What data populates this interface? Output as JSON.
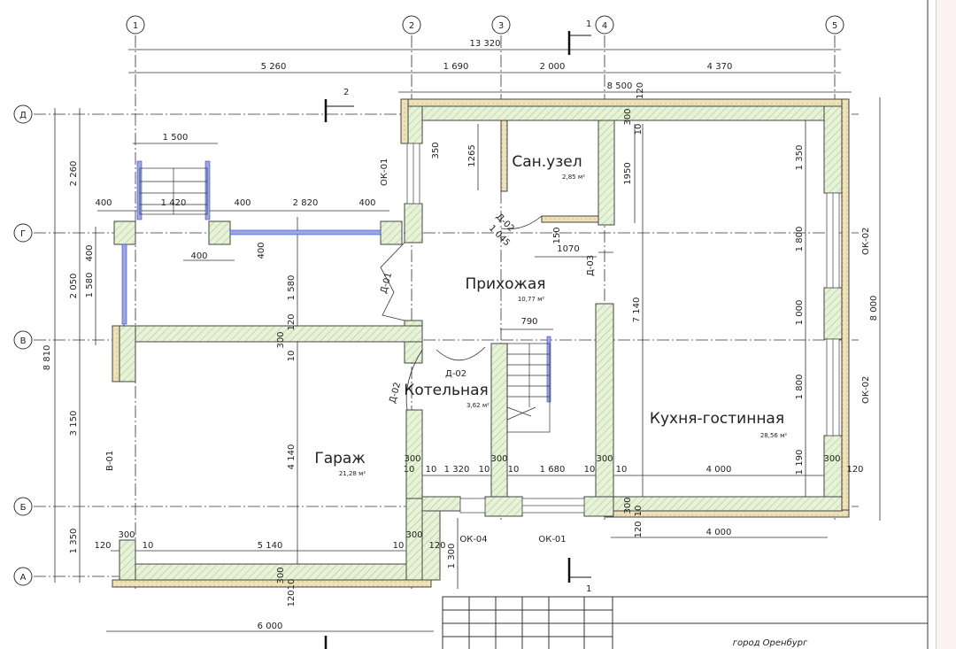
{
  "drawing": {
    "axes_vertical": [
      "1",
      "2",
      "3",
      "4",
      "5"
    ],
    "axes_horizontal": [
      "Д",
      "Г",
      "В",
      "Б",
      "А"
    ],
    "section_1": "1",
    "section_2": "2",
    "rooms": [
      {
        "name": "Сан.узел",
        "area": "2,85 м²"
      },
      {
        "name": "Прихожая",
        "area": "10,77 м²"
      },
      {
        "name": "Котельная",
        "area": "3,62 м²"
      },
      {
        "name": "Гараж",
        "area": "21,28 м²"
      },
      {
        "name": "Кухня-гостинная",
        "area": "28,56 м²"
      }
    ],
    "openings": {
      "ok01_top": "ОК-01",
      "ok02_upper": "ОК-02",
      "ok02_lower": "ОК-02",
      "ok04": "ОК-04",
      "ok01_bottom": "ОК-01",
      "d01": "Д-01",
      "d02_boiler": "Д-02",
      "d02_door": "Д-02",
      "d02_wc": "Д-02",
      "d03": "Д-03",
      "v01": "В-01"
    },
    "dims_top": {
      "total": "13 320",
      "d1": "5 260",
      "d2": "1 690",
      "d3": "2 000",
      "d4": "4 370",
      "inner": "8 500",
      "t120": "120"
    },
    "dims_left": {
      "total": "8 810",
      "l1": "2 260",
      "l2": "2 050",
      "l3": "3 150",
      "l4": "1 350",
      "l5": "400",
      "l6": "1 580"
    },
    "dims_right": {
      "total": "8 000",
      "r1": "1 350",
      "r2": "1 800",
      "r3": "1 000",
      "r4": "1 800",
      "r5": "1 190"
    },
    "dims_porch": {
      "w1500": "1 500",
      "w1420": "1 420",
      "w400a": "400",
      "w400b": "400",
      "w2820": "2 820",
      "w400c": "400",
      "w400d": "400",
      "h400": "400"
    },
    "dims_interior": {
      "d350": "350",
      "d1265": "1265",
      "d1950": "1950",
      "d1045": "1 045",
      "d150": "150",
      "d1070": "1070",
      "d790": "790",
      "d7140": "7 140",
      "d1580": "1 580",
      "d4140": "4 140",
      "d120a": "120",
      "d300a": "300",
      "d10a": "10",
      "d300b": "300",
      "d10b": "10",
      "d300c": "300",
      "d10c": "10",
      "d10d": "10",
      "d1320": "1 320",
      "d10e": "10",
      "d300d": "300",
      "d10f": "10",
      "d1680": "1 680",
      "d10g": "10",
      "d300e": "300",
      "d10h": "10",
      "d4000a": "4 000",
      "d300f": "300",
      "d120b": "120",
      "d120c": "120",
      "d300g": "300",
      "d10i": "10",
      "d5140": "5 140",
      "d10j": "10",
      "d300h": "300",
      "d120d": "120",
      "d1300": "1 300",
      "d300i": "300",
      "d10k": "10",
      "d120e": "120",
      "d6000": "6 000",
      "d4000b": "4 000",
      "d120f": "120",
      "d300j": "300",
      "d10l": "10"
    },
    "title_block": {
      "city": "город Оренбург"
    }
  }
}
